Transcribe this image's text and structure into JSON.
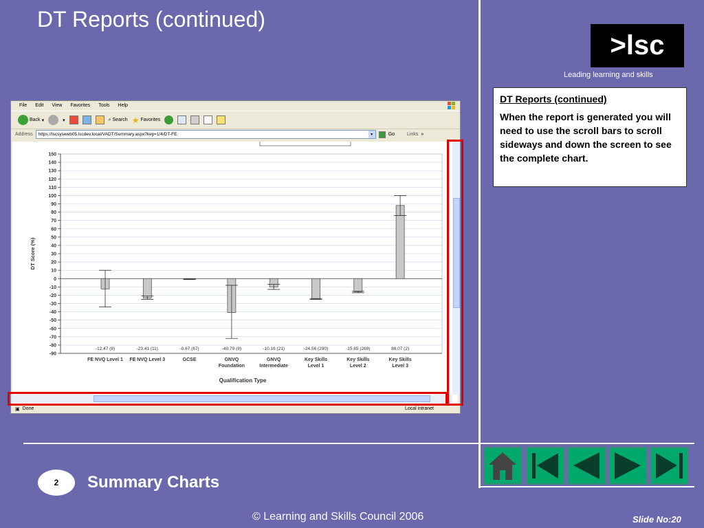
{
  "slide": {
    "title": "DT Reports (continued)",
    "logo_text": ">lsc",
    "tagline": "Leading learning and skills",
    "textbox_title": "DT Reports (continued)",
    "textbox_body": "When the report is generated you will need to use the scroll bars to scroll sideways and down the screen to see the complete chart.",
    "section_number": "2",
    "section_title": "Summary Charts",
    "footer": "© Learning and Skills Council 2006",
    "slide_no": "Slide No:20"
  },
  "browser": {
    "menu": [
      "File",
      "Edit",
      "View",
      "Favorites",
      "Tools",
      "Help"
    ],
    "toolbar": {
      "back": "Back",
      "search": "Search",
      "favorites": "Favorites"
    },
    "address_label": "Address",
    "url": "https://lscsysweb05.lscdev.local/VADT/Summary.aspx?key=1/4/DT-FE",
    "go": "Go",
    "links": "Links",
    "status": "Done",
    "zone": "Local intranet"
  },
  "chart_data": {
    "type": "bar",
    "ylabel": "DT Score (%)",
    "xlabel": "Qualification Type",
    "ylim": [
      -90,
      150
    ],
    "yticks": [
      150,
      140,
      130,
      120,
      110,
      100,
      90,
      80,
      70,
      60,
      50,
      40,
      30,
      20,
      10,
      0,
      -10,
      -20,
      -30,
      -40,
      -50,
      -60,
      -70,
      -80,
      -90
    ],
    "categories": [
      [
        "FE NVQ Level 1"
      ],
      [
        "FE NVQ Level 3"
      ],
      [
        "GCSE"
      ],
      [
        "GNVQ",
        "Foundation"
      ],
      [
        "GNVQ",
        "Intermediate"
      ],
      [
        "Key Skills",
        "Level 1"
      ],
      [
        "Key Skills",
        "Level 2"
      ],
      [
        "Key Skills",
        "Level 3"
      ]
    ],
    "values": [
      -12.47,
      -23.41,
      -0.67,
      -40.79,
      -10.16,
      -24.56,
      -15.85,
      88.07
    ],
    "error_low": [
      -34,
      -25,
      -1,
      -72,
      -13,
      -25,
      -17,
      76
    ],
    "error_high": [
      10,
      -21,
      -0.3,
      -8,
      -7,
      -24,
      -15,
      100
    ],
    "value_labels": [
      "-12.47 (8)",
      "-23.41 (11)",
      "-0.67 (67)",
      "-40.79 (8)",
      "-10.16 (21)",
      "-24.56 (290)",
      "-15.85 (269)",
      "88.07 (2)"
    ],
    "grid": true,
    "bar_color": "#c8c8c8"
  },
  "colors": {
    "background": "#6b68ad",
    "highlight": "#e00000",
    "nav": "#00a86b"
  },
  "nav": {
    "icons": [
      "home-icon",
      "first-slide-icon",
      "previous-slide-icon",
      "next-slide-icon",
      "last-slide-icon"
    ]
  }
}
